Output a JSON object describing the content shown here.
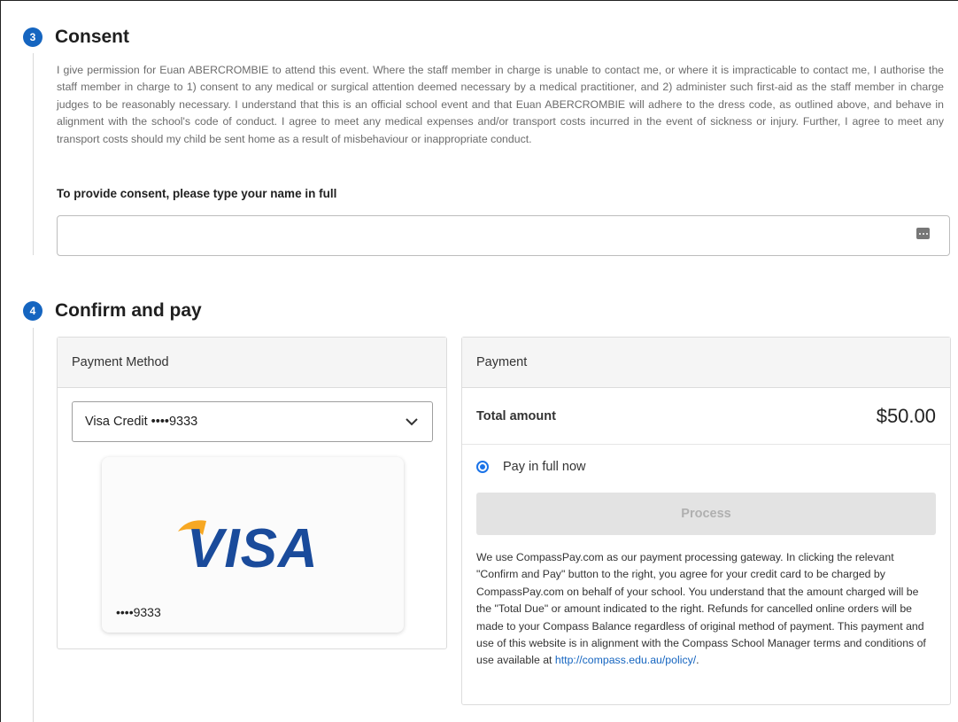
{
  "consent": {
    "step_number": "3",
    "title": "Consent",
    "text": "I give permission for Euan ABERCROMBIE to attend this event. Where the staff member in charge is unable to contact me, or where it is impracticable to contact me, I authorise the staff member in charge to 1) consent to any medical or surgical attention deemed necessary by a medical practitioner, and 2) administer such first-aid as the staff member in charge judges to be reasonably necessary. I understand that this is an official school event and that Euan ABERCROMBIE will adhere to the dress code, as outlined above, and behave in alignment with the school's code of conduct. I agree to meet any medical expenses and/or transport costs incurred in the event of sickness or injury. Further, I agree to meet any transport costs should my child be sent home as a result of misbehaviour or inappropriate conduct.",
    "name_label": "To provide consent, please type your name in full",
    "name_value": "",
    "name_placeholder": "",
    "input_icon": "password-manager-key-icon"
  },
  "confirm": {
    "step_number": "4",
    "title": "Confirm and pay",
    "payment_method": {
      "header": "Payment Method",
      "selected": "Visa Credit ••••9333",
      "card_brand": "VISA",
      "card_digits": "••••9333",
      "chevron_icon": "chevron-down-icon"
    },
    "payment": {
      "header": "Payment",
      "total_label": "Total amount",
      "total_value": "$50.00",
      "option_label": "Pay in full now",
      "process_label": "Process",
      "note_text": "We use CompassPay.com as our payment processing gateway. In clicking the relevant \"Confirm and Pay\" button to the right, you agree for your credit card to be charged by CompassPay.com on behalf of your school. You understand that the amount charged will be the \"Total Due\" or amount indicated to the right. Refunds for cancelled online orders will be made to your Compass Balance regardless of original method of payment. This payment and use of this website is in alignment with the Compass School Manager terms and conditions of use available at",
      "link_text": "http://compass.edu.au/policy/",
      "link_suffix": "."
    }
  },
  "colors": {
    "accent": "#1565c0",
    "radio": "#1a73e8",
    "visa_blue": "#1a4b9b",
    "visa_gold": "#f7a823",
    "button_disabled": "#e3e3e3"
  }
}
